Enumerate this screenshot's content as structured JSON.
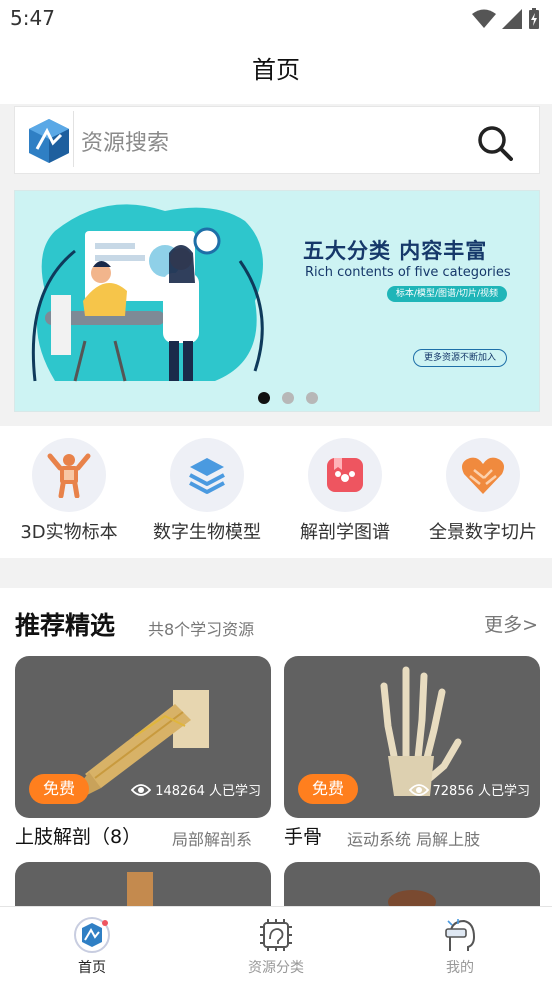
{
  "status_bar": {
    "time": "5:47"
  },
  "header": {
    "title": "首页"
  },
  "search": {
    "placeholder": "资源搜索"
  },
  "banner": {
    "title": "五大分类 内容丰富",
    "subtitle": "Rich contents of five categories",
    "tag": "标本/模型/图谱/切片/视频",
    "more": "更多资源不断加入",
    "active_index": 0,
    "slide_count": 3
  },
  "categories": [
    {
      "label": "3D实物标本",
      "icon": "anatomy-specimen-icon"
    },
    {
      "label": "数字生物模型",
      "icon": "layers-icon"
    },
    {
      "label": "解剖学图谱",
      "icon": "atlas-icon"
    },
    {
      "label": "全景数字切片",
      "icon": "heart-hands-icon"
    }
  ],
  "recommend": {
    "title": "推荐精选",
    "subtitle": "共8个学习资源",
    "more": "更多>",
    "items": [
      {
        "badge": "免费",
        "views": "148264 人已学习",
        "name": "上肢解剖（8）",
        "tags": "局部解剖系"
      },
      {
        "badge": "免费",
        "views": "72856 人已学习",
        "name": "手骨",
        "tags": "运动系统 局解上肢"
      }
    ]
  },
  "tabbar": {
    "items": [
      {
        "label": "首页",
        "icon": "home-logo-icon",
        "active": true
      },
      {
        "label": "资源分类",
        "icon": "chip-category-icon",
        "active": false
      },
      {
        "label": "我的",
        "icon": "vr-head-icon",
        "active": false
      }
    ]
  },
  "colors": {
    "accent_orange": "#ff7f1e",
    "banner_bg": "#cdf3f3",
    "card_bg": "#616161"
  }
}
